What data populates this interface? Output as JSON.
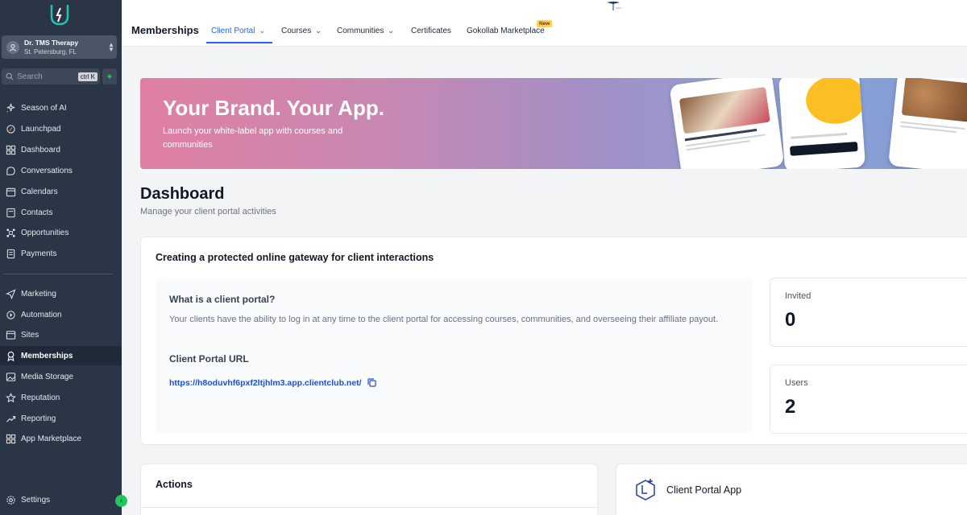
{
  "account": {
    "name": "Dr. TMS Therapy",
    "location": "St. Petersburg, FL"
  },
  "search": {
    "placeholder": "Search",
    "shortcut": "ctrl K"
  },
  "sidebar": {
    "items": [
      {
        "label": "Season of AI",
        "icon": "sparkle-icon",
        "active": false
      },
      {
        "label": "Launchpad",
        "icon": "rocket-icon",
        "active": false
      },
      {
        "label": "Dashboard",
        "icon": "grid-icon",
        "active": false
      },
      {
        "label": "Conversations",
        "icon": "chat-icon",
        "active": false
      },
      {
        "label": "Calendars",
        "icon": "calendar-icon",
        "active": false
      },
      {
        "label": "Contacts",
        "icon": "contacts-icon",
        "active": false
      },
      {
        "label": "Opportunities",
        "icon": "opportunities-icon",
        "active": false
      },
      {
        "label": "Payments",
        "icon": "payments-icon",
        "active": false
      },
      {
        "label": "Marketing",
        "icon": "send-icon",
        "active": false
      },
      {
        "label": "Automation",
        "icon": "automation-icon",
        "active": false
      },
      {
        "label": "Sites",
        "icon": "sites-icon",
        "active": false
      },
      {
        "label": "Memberships",
        "icon": "award-icon",
        "active": true
      },
      {
        "label": "Media Storage",
        "icon": "image-icon",
        "active": false
      },
      {
        "label": "Reputation",
        "icon": "star-icon",
        "active": false
      },
      {
        "label": "Reporting",
        "icon": "trend-icon",
        "active": false
      },
      {
        "label": "App Marketplace",
        "icon": "apps-icon",
        "active": false
      }
    ],
    "settings_label": "Settings"
  },
  "header": {
    "title": "Memberships",
    "tabs": [
      {
        "label": "Client Portal",
        "dropdown": true,
        "active": true
      },
      {
        "label": "Courses",
        "dropdown": true,
        "active": false
      },
      {
        "label": "Communities",
        "dropdown": true,
        "active": false
      },
      {
        "label": "Certificates",
        "dropdown": false,
        "active": false
      },
      {
        "label": "Gokollab Marketplace",
        "dropdown": false,
        "active": false
      }
    ],
    "new_badge": "New"
  },
  "banner": {
    "title": "Your Brand. Your App.",
    "subtitle": "Launch your white-label app with courses and communities"
  },
  "dashboard": {
    "title": "Dashboard",
    "subtitle": "Manage your client portal activities"
  },
  "gateway_card": {
    "heading": "Creating a protected online gateway for client interactions",
    "question": "What is a client portal?",
    "description": "Your clients have the ability to log in at any time to the client portal for accessing courses, communities, and overseeing their affiliate payout.",
    "url_label": "Client Portal URL",
    "url": "https://h8oduvhf6pxf2ltjhlm3.app.clientclub.net/"
  },
  "stats": [
    {
      "label": "Invited",
      "value": "0"
    },
    {
      "label": "Users",
      "value": "2"
    }
  ],
  "actions_card": {
    "title": "Actions"
  },
  "app_card": {
    "title": "Client Portal App"
  },
  "colors": {
    "sidebar_bg": "#2a3646",
    "accent": "#2563eb",
    "active_item_bg": "#1f2937",
    "green": "#22c55e"
  }
}
